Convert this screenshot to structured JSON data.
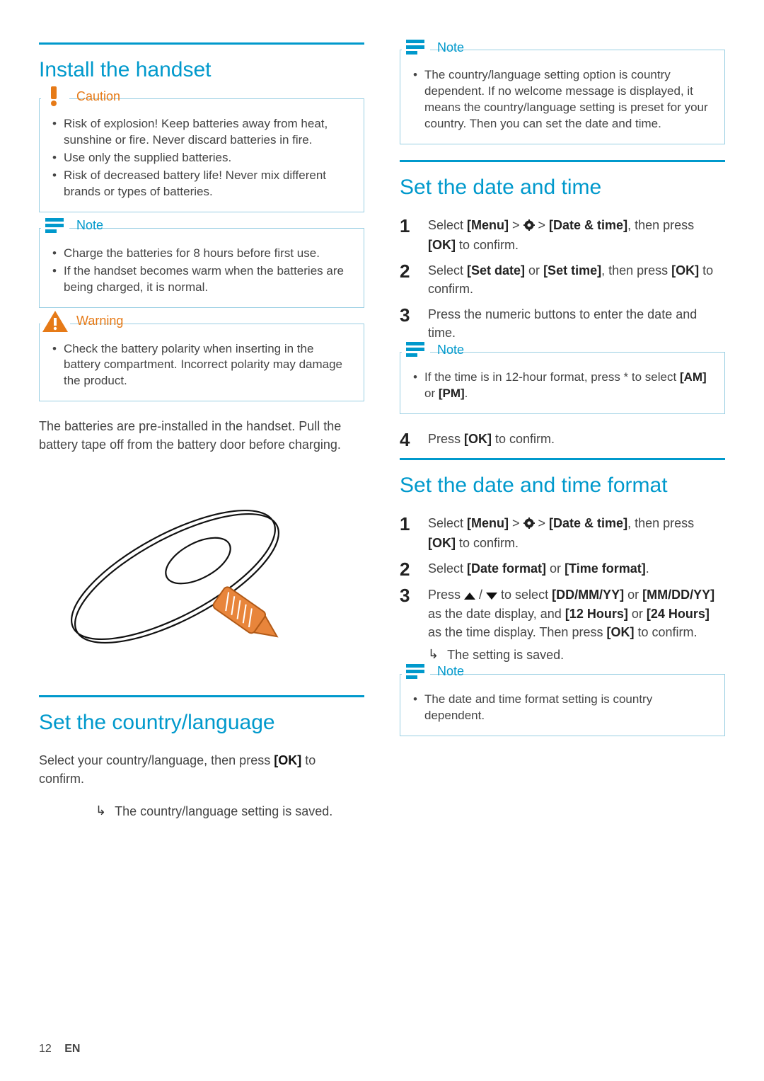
{
  "footer": {
    "page_number": "12",
    "lang": "EN"
  },
  "left": {
    "heading1": "Install the handset",
    "caution": {
      "title": "Caution",
      "items": [
        "Risk of explosion! Keep batteries away from heat, sunshine or fire. Never discard batteries in fire.",
        "Use only the supplied batteries.",
        "Risk of decreased battery life! Never mix different brands or types of batteries."
      ]
    },
    "note1": {
      "title": "Note",
      "items": [
        "Charge the batteries for 8 hours before first use.",
        "If the handset becomes warm when the batteries are being charged, it is normal."
      ]
    },
    "warning": {
      "title": "Warning",
      "items": [
        "Check the battery polarity when inserting in the battery compartment. Incorrect polarity may damage the product."
      ]
    },
    "body1": "The batteries are pre-installed in the handset. Pull the battery tape off from the battery door before charging.",
    "heading2": "Set the country/language",
    "body2_pre": "Select your country/language, then press ",
    "body2_ok": "[OK]",
    "body2_post": " to confirm.",
    "result1": "The country/language setting is saved."
  },
  "right": {
    "note1": {
      "title": "Note",
      "items": [
        "The country/language setting option is country dependent. If no welcome message is displayed, it means the country/language setting is preset for your country. Then you can set the date and time."
      ]
    },
    "heading1": "Set the date and time",
    "steps1": {
      "s1": {
        "pre": "Select ",
        "menu": "[Menu]",
        "gt1": " > ",
        "gt2": " > ",
        "target": "[Date & time]",
        "post": ", then press ",
        "ok": "[OK]",
        "end": " to confirm."
      },
      "s2": {
        "pre": "Select ",
        "a": "[Set date]",
        "or": " or ",
        "b": "[Set time]",
        "post": ", then press ",
        "ok": "[OK]",
        "end": " to confirm."
      },
      "s3": "Press the numeric buttons to enter the date and time."
    },
    "note2": {
      "title": "Note",
      "item_pre": "If the time is in 12-hour format, press * to select ",
      "am": "[AM]",
      "or": " or ",
      "pm": "[PM]",
      "end": "."
    },
    "step4": {
      "pre": "Press ",
      "ok": "[OK]",
      "end": " to confirm."
    },
    "heading2": "Set the date and time format",
    "steps2": {
      "s1": {
        "pre": "Select ",
        "menu": "[Menu]",
        "gt1": " > ",
        "gt2": " > ",
        "target": "[Date & time]",
        "post": ", then press ",
        "ok": "[OK]",
        "end": " to confirm."
      },
      "s2": {
        "pre": "Select ",
        "a": "[Date format]",
        "or": " or ",
        "b": "[Time format]",
        "end": "."
      },
      "s3": {
        "pre": "Press ",
        "mid": " to select ",
        "dd": "[DD/MM/YY]",
        "or1": " or ",
        "mm": "[MM/DD/YY]",
        "asdate": " as the date display, and ",
        "h12": "[12 Hours]",
        "or2": " or ",
        "h24": "[24 Hours]",
        "astime": " as the time display. Then press ",
        "ok": "[OK]",
        "end": " to confirm."
      }
    },
    "result2": "The setting is saved.",
    "note3": {
      "title": "Note",
      "items": [
        "The date and time format setting is country dependent."
      ]
    }
  }
}
